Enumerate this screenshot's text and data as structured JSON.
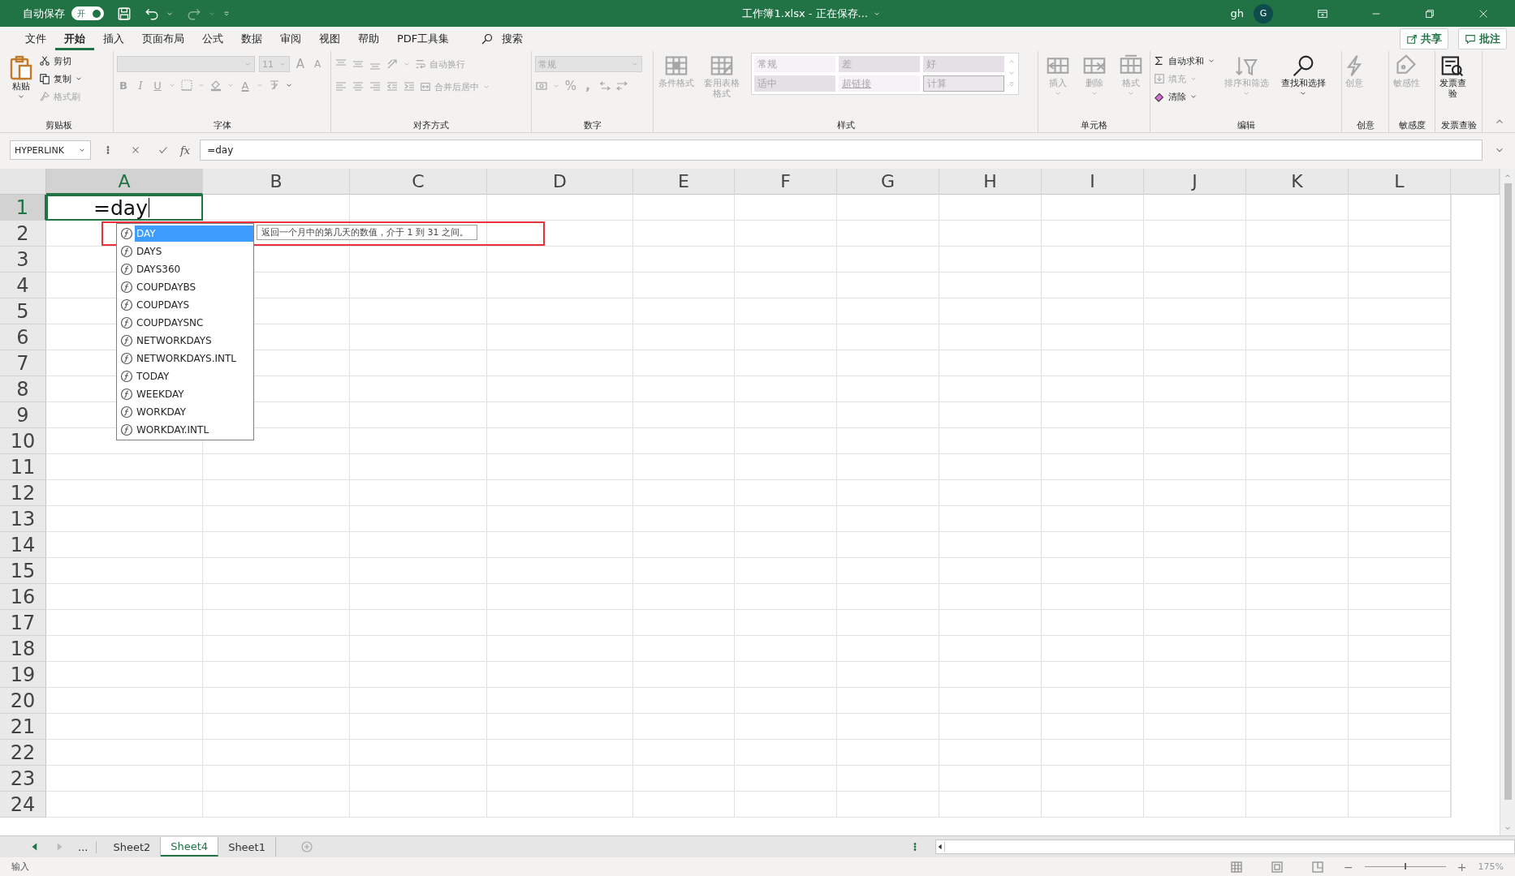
{
  "title_bar": {
    "autosave": {
      "label": "自动保存",
      "on": true,
      "state_text": "开"
    },
    "title": "工作簿1.xlsx - 正在保存...",
    "user": "gh",
    "avatar": "G"
  },
  "menu": {
    "tabs": [
      {
        "label": "文件",
        "selected": false
      },
      {
        "label": "开始",
        "selected": true
      },
      {
        "label": "插入",
        "selected": false
      },
      {
        "label": "页面布局",
        "selected": false
      },
      {
        "label": "公式",
        "selected": false
      },
      {
        "label": "数据",
        "selected": false
      },
      {
        "label": "审阅",
        "selected": false
      },
      {
        "label": "视图",
        "selected": false
      },
      {
        "label": "帮助",
        "selected": false
      },
      {
        "label": "PDF工具集",
        "selected": false
      }
    ],
    "search": "搜索",
    "share": "共享",
    "comments": "批注"
  },
  "ribbon": {
    "clipboard": {
      "label": "剪贴板",
      "paste": "粘贴",
      "cut": {
        "label": "剪切",
        "disabled": false
      },
      "copy": {
        "label": "复制",
        "disabled": false
      },
      "format_painter": {
        "label": "格式刷",
        "disabled": true
      }
    },
    "font": {
      "label": "字体",
      "size": "11",
      "grow": "A",
      "shrink": "A",
      "bold": "B",
      "italic": "I",
      "underline": "U",
      "font_color": "A"
    },
    "alignment": {
      "label": "对齐方式",
      "wrap_text": {
        "label": "自动换行",
        "disabled": true
      },
      "merge": {
        "label": "合并后居中",
        "disabled": true
      }
    },
    "number": {
      "label": "数字",
      "format": "常规",
      "percent": "%",
      "comma": ","
    },
    "styles": {
      "label": "样式",
      "conditional": {
        "label": "条件格式",
        "disabled": true
      },
      "table_format": {
        "label": "套用表格格式",
        "disabled": true
      },
      "cell_styles": [
        {
          "label": "常规",
          "kind": "normal"
        },
        {
          "label": "差",
          "kind": "bad"
        },
        {
          "label": "好",
          "kind": "good"
        },
        {
          "label": "适中",
          "kind": "neutral"
        },
        {
          "label": "超链接",
          "kind": "hyperlink"
        },
        {
          "label": "计算",
          "kind": "calculation"
        }
      ]
    },
    "cells": {
      "label": "单元格",
      "buttons": [
        {
          "label": "插入",
          "disabled": true
        },
        {
          "label": "删除",
          "disabled": true
        },
        {
          "label": "格式",
          "disabled": true
        }
      ]
    },
    "editing": {
      "label": "编辑",
      "autosum": {
        "label": "自动求和",
        "disabled": false
      },
      "fill": {
        "label": "填充",
        "disabled": true
      },
      "clear": {
        "label": "清除",
        "disabled": false
      },
      "sort": {
        "label": "排序和筛选",
        "disabled": true
      },
      "find": {
        "label": "查找和选择",
        "disabled": false
      }
    },
    "creative": {
      "label": "创意",
      "button": {
        "label": "创意",
        "disabled": true
      }
    },
    "sensitivity": {
      "label": "敏感度",
      "button": {
        "label": "敏感性",
        "disabled": true
      }
    },
    "invoice": {
      "label": "发票查验",
      "button": {
        "label": "发票查验",
        "disabled": false
      }
    }
  },
  "formula_bar": {
    "name_box": "HYPERLINK",
    "fx": "fx",
    "formula": "=day"
  },
  "sheet": {
    "columns": [
      "A",
      "B",
      "C",
      "D",
      "E",
      "F",
      "G",
      "H",
      "I",
      "J",
      "K",
      "L"
    ],
    "rows": [
      "1",
      "2",
      "3",
      "4",
      "5",
      "6",
      "7",
      "8",
      "9",
      "10",
      "11",
      "12",
      "13",
      "14",
      "15",
      "16",
      "17",
      "18",
      "19",
      "20",
      "21",
      "22",
      "23",
      "24"
    ],
    "active_cell": {
      "value": "=day"
    },
    "autocomplete": {
      "items": [
        {
          "label": "DAY",
          "selected": true
        },
        {
          "label": "DAYS",
          "selected": false
        },
        {
          "label": "DAYS360",
          "selected": false
        },
        {
          "label": "COUPDAYBS",
          "selected": false
        },
        {
          "label": "COUPDAYS",
          "selected": false
        },
        {
          "label": "COUPDAYSNC",
          "selected": false
        },
        {
          "label": "NETWORKDAYS",
          "selected": false
        },
        {
          "label": "NETWORKDAYS.INTL",
          "selected": false
        },
        {
          "label": "TODAY",
          "selected": false
        },
        {
          "label": "WEEKDAY",
          "selected": false
        },
        {
          "label": "WORKDAY",
          "selected": false
        },
        {
          "label": "WORKDAY.INTL",
          "selected": false
        }
      ],
      "tooltip": "返回一个月中的第几天的数值，介于 1 到 31 之间。"
    }
  },
  "sheet_tabs": {
    "more": "...",
    "tabs": [
      {
        "label": "Sheet2",
        "selected": false
      },
      {
        "label": "Sheet4",
        "selected": true
      },
      {
        "label": "Sheet1",
        "selected": false
      }
    ]
  },
  "status_bar": {
    "mode": "输入",
    "zoom_out": "−",
    "zoom_in": "+",
    "zoom": {
      "level": 0.5
    },
    "zoom_percent": "175%"
  }
}
